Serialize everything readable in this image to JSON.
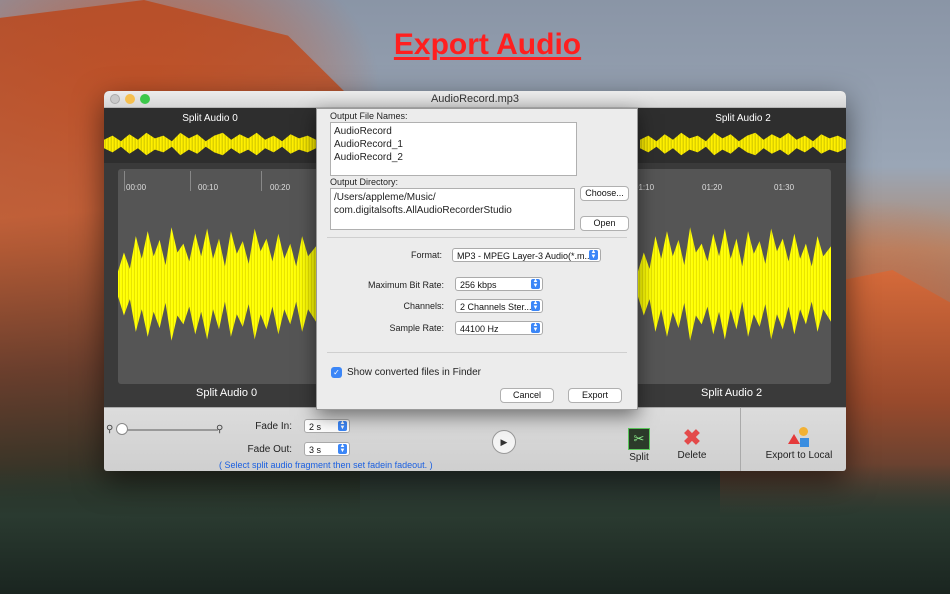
{
  "headline": "Export Audio",
  "window": {
    "title": "AudioRecord.mp3"
  },
  "strip": {
    "segments": [
      "Split Audio 0",
      "Split Audio 2"
    ]
  },
  "timeline": {
    "ticks": [
      "00:00",
      "00:10",
      "00:20",
      "01:10",
      "01:20",
      "01:30"
    ]
  },
  "segment_labels": [
    "Split Audio 0",
    "Split Audio 2"
  ],
  "bottombar": {
    "fade_in_label": "Fade In:",
    "fade_in_value": "2 s",
    "fade_out_label": "Fade Out:",
    "fade_out_value": "3 s",
    "hint": "( Select split audio fragment then set fadein fadeout. )",
    "split_label": "Split",
    "delete_label": "Delete",
    "export_label": "Export to Local"
  },
  "sheet": {
    "output_file_names_label": "Output File Names:",
    "file_names": [
      "AudioRecord",
      "AudioRecord_1",
      "AudioRecord_2"
    ],
    "output_directory_label": "Output Directory:",
    "directory_line1": "/Users/appleme/Music/",
    "directory_line2": "com.digitalsofts.AllAudioRecorderStudio",
    "choose_button": "Choose...",
    "open_button": "Open",
    "format_label": "Format:",
    "format_value": "MP3 - MPEG Layer-3 Audio(*.m...",
    "bitrate_label": "Maximum Bit Rate:",
    "bitrate_value": "256 kbps",
    "channels_label": "Channels:",
    "channels_value": "2 Channels Ster...",
    "sample_rate_label": "Sample Rate:",
    "sample_rate_value": "44100 Hz",
    "show_in_finder": "Show converted files in Finder",
    "show_in_finder_checked": true,
    "cancel_button": "Cancel",
    "export_button": "Export"
  },
  "colors": {
    "headline": "#ff1f1f",
    "waveform": "#ffff00",
    "accent_blue": "#3b86f7"
  }
}
